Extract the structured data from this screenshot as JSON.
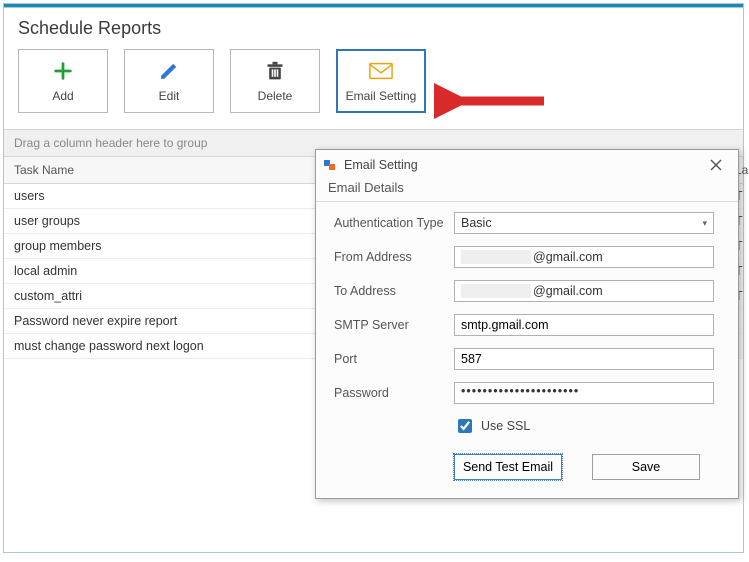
{
  "page": {
    "title": "Schedule Reports"
  },
  "toolbar": {
    "add": "Add",
    "edit": "Edit",
    "delete": "Delete",
    "email_setting": "Email Setting"
  },
  "grid": {
    "group_hint": "Drag a column header here to group",
    "columns": {
      "task_name": "Task Name",
      "last_col": "La"
    },
    "rows": [
      {
        "name": "users",
        "last": "Th"
      },
      {
        "name": "user groups",
        "last": "Th"
      },
      {
        "name": "group members",
        "last": "Th"
      },
      {
        "name": "local admin",
        "last": "Th"
      },
      {
        "name": "custom_attri",
        "last": "Th"
      },
      {
        "name": "Password never expire report",
        "last": ""
      },
      {
        "name": "must change password next logon",
        "last": ""
      }
    ]
  },
  "dialog": {
    "title": "Email Setting",
    "section": "Email Details",
    "labels": {
      "auth_type": "Authentication Type",
      "from": "From Address",
      "to": "To Address",
      "smtp": "SMTP Server",
      "port": "Port",
      "password": "Password",
      "use_ssl": "Use SSL"
    },
    "values": {
      "auth_type": "Basic",
      "from_suffix": "@gmail.com",
      "to_suffix": "@gmail.com",
      "smtp": "smtp.gmail.com",
      "port": "587",
      "password": "••••••••••••••••••••••",
      "use_ssl": true
    },
    "buttons": {
      "send_test": "Send Test Email",
      "save": "Save"
    }
  }
}
